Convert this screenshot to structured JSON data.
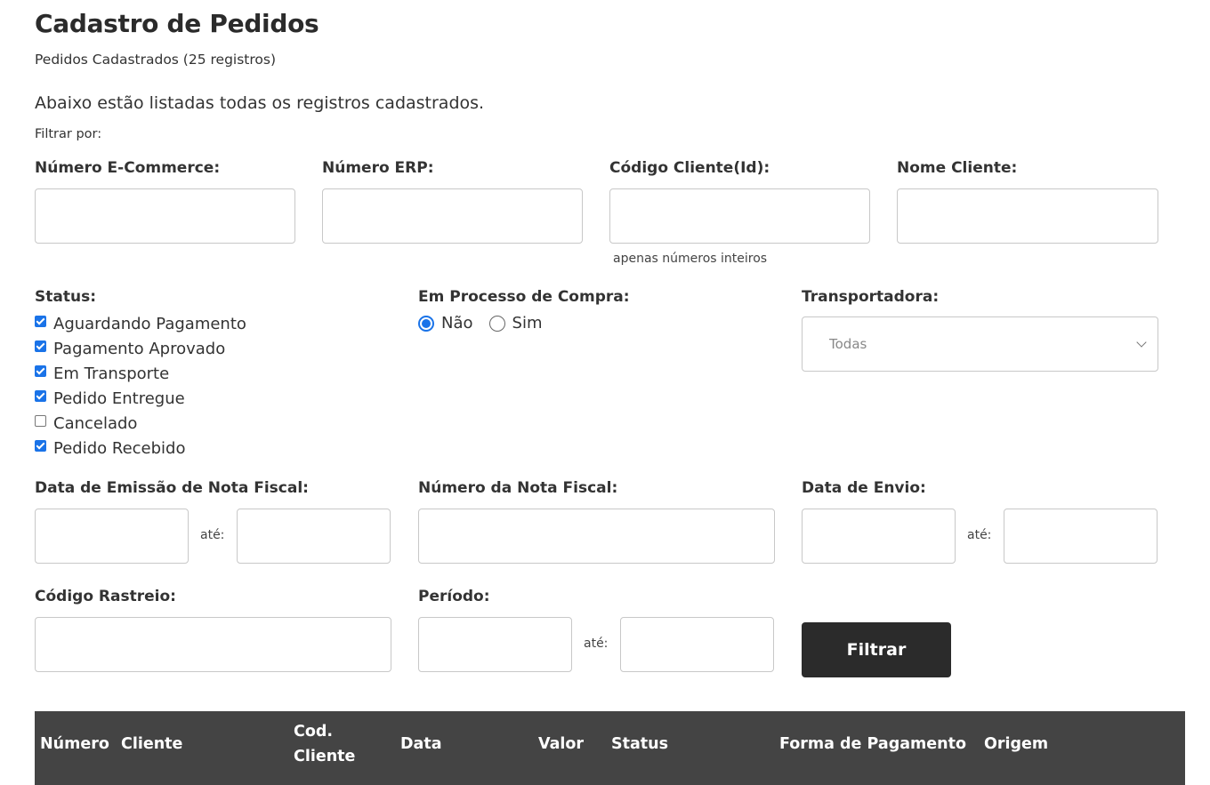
{
  "page": {
    "title": "Cadastro de Pedidos",
    "subtitle": "Pedidos Cadastrados (25 registros)",
    "intro": "Abaixo estão listadas todas os registros cadastrados.",
    "filter_by": "Filtrar por:"
  },
  "filters": {
    "ecommerce": {
      "label": "Número E-Commerce:",
      "value": ""
    },
    "erp": {
      "label": "Número ERP:",
      "value": ""
    },
    "client_code": {
      "label": "Código Cliente(Id):",
      "value": "",
      "hint": "apenas números inteiros"
    },
    "client_name": {
      "label": "Nome Cliente:",
      "value": ""
    },
    "status": {
      "label": "Status:",
      "options": [
        {
          "label": "Aguardando Pagamento",
          "checked": true
        },
        {
          "label": "Pagamento Aprovado",
          "checked": true
        },
        {
          "label": "Em Transporte",
          "checked": true
        },
        {
          "label": "Pedido Entregue",
          "checked": true
        },
        {
          "label": "Cancelado",
          "checked": false
        },
        {
          "label": "Pedido Recebido",
          "checked": true
        }
      ]
    },
    "purchase_process": {
      "label": "Em Processo de Compra:",
      "options": [
        {
          "label": "Não",
          "selected": true
        },
        {
          "label": "Sim",
          "selected": false
        }
      ]
    },
    "carrier": {
      "label": "Transportadora:",
      "selected": "Todas"
    },
    "invoice_date": {
      "label": "Data de Emissão de Nota Fiscal:",
      "from": "",
      "to": "",
      "until": "até:"
    },
    "invoice_number": {
      "label": "Número da Nota Fiscal:",
      "value": ""
    },
    "ship_date": {
      "label": "Data de Envio:",
      "from": "",
      "to": "",
      "until": "até:"
    },
    "tracking": {
      "label": "Código Rastreio:",
      "value": ""
    },
    "period": {
      "label": "Período:",
      "from": "",
      "to": "",
      "until": "até:"
    },
    "submit_label": "Filtrar"
  },
  "table": {
    "columns": {
      "number": "Número",
      "client": "Cliente",
      "client_code_1": "Cod.",
      "client_code_2": "Cliente",
      "date": "Data",
      "value": "Valor",
      "status": "Status",
      "payment": "Forma de Pagamento",
      "origin": "Origem"
    }
  },
  "colors": {
    "accent": "#1a73e8",
    "button": "#2b2b2b",
    "table_header": "#444444"
  }
}
